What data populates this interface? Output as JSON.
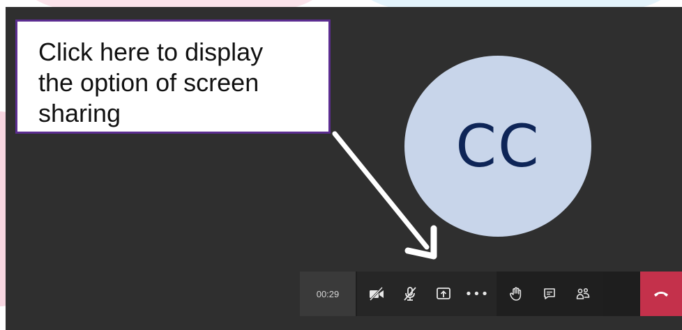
{
  "callout": {
    "text": "Click here to display\nthe option of screen\nsharing"
  },
  "participant": {
    "initials": "CC"
  },
  "toolbar": {
    "timer": "00:29",
    "more_glyph": "•••"
  },
  "icons": {
    "camera": "camera-off-icon",
    "mic": "mic-off-icon",
    "share": "share-screen-icon",
    "more": "more-options-icon",
    "hand": "raise-hand-icon",
    "chat": "chat-icon",
    "people": "participants-icon",
    "hangup": "hang-up-icon"
  },
  "colors": {
    "callout_border": "#5c2d91",
    "avatar_bg": "#c8d5ea",
    "avatar_text": "#0e2557",
    "hangup": "#c4314b"
  }
}
